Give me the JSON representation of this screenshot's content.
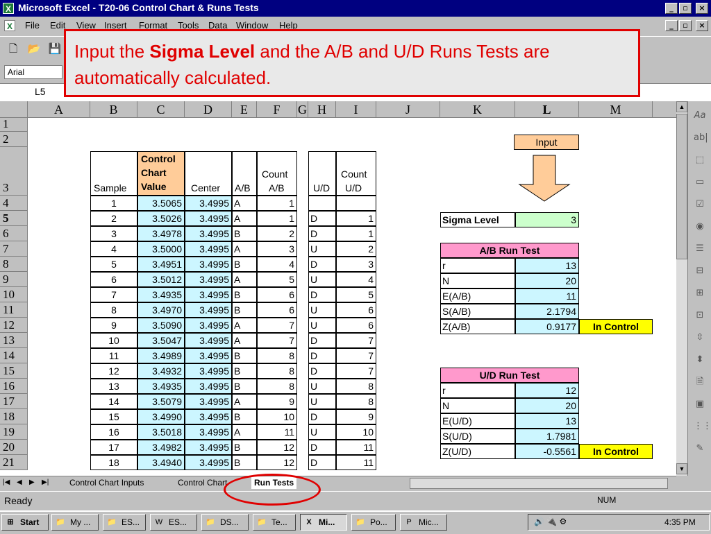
{
  "window": {
    "title": "Microsoft Excel - T20-06 Control Chart & Runs Tests"
  },
  "menu": [
    "File",
    "Edit",
    "View",
    "Insert",
    "Format",
    "Tools",
    "Data",
    "Window",
    "Help"
  ],
  "toolbar": {
    "font": "Arial"
  },
  "namebox": {
    "ref": "L5"
  },
  "callout": {
    "pre": "Input the ",
    "bold": "Sigma Level",
    "post": " and the A/B and U/D Runs Tests are automatically calculated."
  },
  "columns": [
    "A",
    "B",
    "C",
    "D",
    "E",
    "F",
    "G",
    "H",
    "I",
    "J",
    "K",
    "L",
    "M"
  ],
  "rows": [
    "1",
    "2",
    "3",
    "4",
    "5",
    "6",
    "7",
    "8",
    "9",
    "10",
    "11",
    "12",
    "13",
    "14",
    "15",
    "16",
    "17",
    "18",
    "19",
    "20",
    "21"
  ],
  "headers": {
    "sample": "Sample",
    "ccv_line1": "Control",
    "ccv_line2": "Chart",
    "ccv_line3": "Value",
    "center": "Center",
    "ab": "A/B",
    "count_ab_line1": "Count",
    "count_ab_line2": "A/B",
    "ud": "U/D",
    "count_ud_line1": "Count",
    "count_ud_line2": "U/D"
  },
  "data_rows": [
    {
      "sample": "1",
      "ccv": "3.5065",
      "center": "3.4995",
      "ab": "A",
      "count_ab": "1",
      "ud": "",
      "count_ud": ""
    },
    {
      "sample": "2",
      "ccv": "3.5026",
      "center": "3.4995",
      "ab": "A",
      "count_ab": "1",
      "ud": "D",
      "count_ud": "1"
    },
    {
      "sample": "3",
      "ccv": "3.4978",
      "center": "3.4995",
      "ab": "B",
      "count_ab": "2",
      "ud": "D",
      "count_ud": "1"
    },
    {
      "sample": "4",
      "ccv": "3.5000",
      "center": "3.4995",
      "ab": "A",
      "count_ab": "3",
      "ud": "U",
      "count_ud": "2"
    },
    {
      "sample": "5",
      "ccv": "3.4951",
      "center": "3.4995",
      "ab": "B",
      "count_ab": "4",
      "ud": "D",
      "count_ud": "3"
    },
    {
      "sample": "6",
      "ccv": "3.5012",
      "center": "3.4995",
      "ab": "A",
      "count_ab": "5",
      "ud": "U",
      "count_ud": "4"
    },
    {
      "sample": "7",
      "ccv": "3.4935",
      "center": "3.4995",
      "ab": "B",
      "count_ab": "6",
      "ud": "D",
      "count_ud": "5"
    },
    {
      "sample": "8",
      "ccv": "3.4970",
      "center": "3.4995",
      "ab": "B",
      "count_ab": "6",
      "ud": "U",
      "count_ud": "6"
    },
    {
      "sample": "9",
      "ccv": "3.5090",
      "center": "3.4995",
      "ab": "A",
      "count_ab": "7",
      "ud": "U",
      "count_ud": "6"
    },
    {
      "sample": "10",
      "ccv": "3.5047",
      "center": "3.4995",
      "ab": "A",
      "count_ab": "7",
      "ud": "D",
      "count_ud": "7"
    },
    {
      "sample": "11",
      "ccv": "3.4989",
      "center": "3.4995",
      "ab": "B",
      "count_ab": "8",
      "ud": "D",
      "count_ud": "7"
    },
    {
      "sample": "12",
      "ccv": "3.4932",
      "center": "3.4995",
      "ab": "B",
      "count_ab": "8",
      "ud": "D",
      "count_ud": "7"
    },
    {
      "sample": "13",
      "ccv": "3.4935",
      "center": "3.4995",
      "ab": "B",
      "count_ab": "8",
      "ud": "U",
      "count_ud": "8"
    },
    {
      "sample": "14",
      "ccv": "3.5079",
      "center": "3.4995",
      "ab": "A",
      "count_ab": "9",
      "ud": "U",
      "count_ud": "8"
    },
    {
      "sample": "15",
      "ccv": "3.4990",
      "center": "3.4995",
      "ab": "B",
      "count_ab": "10",
      "ud": "D",
      "count_ud": "9"
    },
    {
      "sample": "16",
      "ccv": "3.5018",
      "center": "3.4995",
      "ab": "A",
      "count_ab": "11",
      "ud": "U",
      "count_ud": "10"
    },
    {
      "sample": "17",
      "ccv": "3.4982",
      "center": "3.4995",
      "ab": "B",
      "count_ab": "12",
      "ud": "D",
      "count_ud": "11"
    },
    {
      "sample": "18",
      "ccv": "3.4940",
      "center": "3.4995",
      "ab": "B",
      "count_ab": "12",
      "ud": "D",
      "count_ud": "11"
    }
  ],
  "input_label": "Input",
  "sigma": {
    "label": "Sigma Level",
    "value": "3"
  },
  "ab_test": {
    "title": "A/B Run Test",
    "rows": [
      {
        "label": "r",
        "value": "13"
      },
      {
        "label": "N",
        "value": "20"
      },
      {
        "label": "E(A/B)",
        "value": "11"
      },
      {
        "label": "S(A/B)",
        "value": "2.1794"
      },
      {
        "label": "Z(A/B)",
        "value": "0.9177"
      }
    ],
    "result": "In Control"
  },
  "ud_test": {
    "title": "U/D Run Test",
    "rows": [
      {
        "label": "r",
        "value": "12"
      },
      {
        "label": "N",
        "value": "20"
      },
      {
        "label": "E(U/D)",
        "value": "13"
      },
      {
        "label": "S(U/D)",
        "value": "1.7981"
      },
      {
        "label": "Z(U/D)",
        "value": "-0.5561"
      }
    ],
    "result": "In Control"
  },
  "sheet_tabs": [
    "Control Chart Inputs",
    "Control Chart",
    "Run Tests"
  ],
  "status": {
    "text": "Ready",
    "num": "NUM"
  },
  "taskbar": {
    "start": "Start",
    "items": [
      "My ...",
      "ES...",
      "ES...",
      "DS...",
      "Te...",
      "Mi...",
      "Po...",
      "Mic..."
    ],
    "clock": "4:35 PM"
  },
  "colors": {
    "accent": "#e00000",
    "title_bar": "#000080",
    "cell_blue": "#ccf6ff",
    "cell_green": "#ccffcc",
    "pink": "#ff99cc",
    "yellow": "#ffff00",
    "peach": "#ffcc99"
  }
}
